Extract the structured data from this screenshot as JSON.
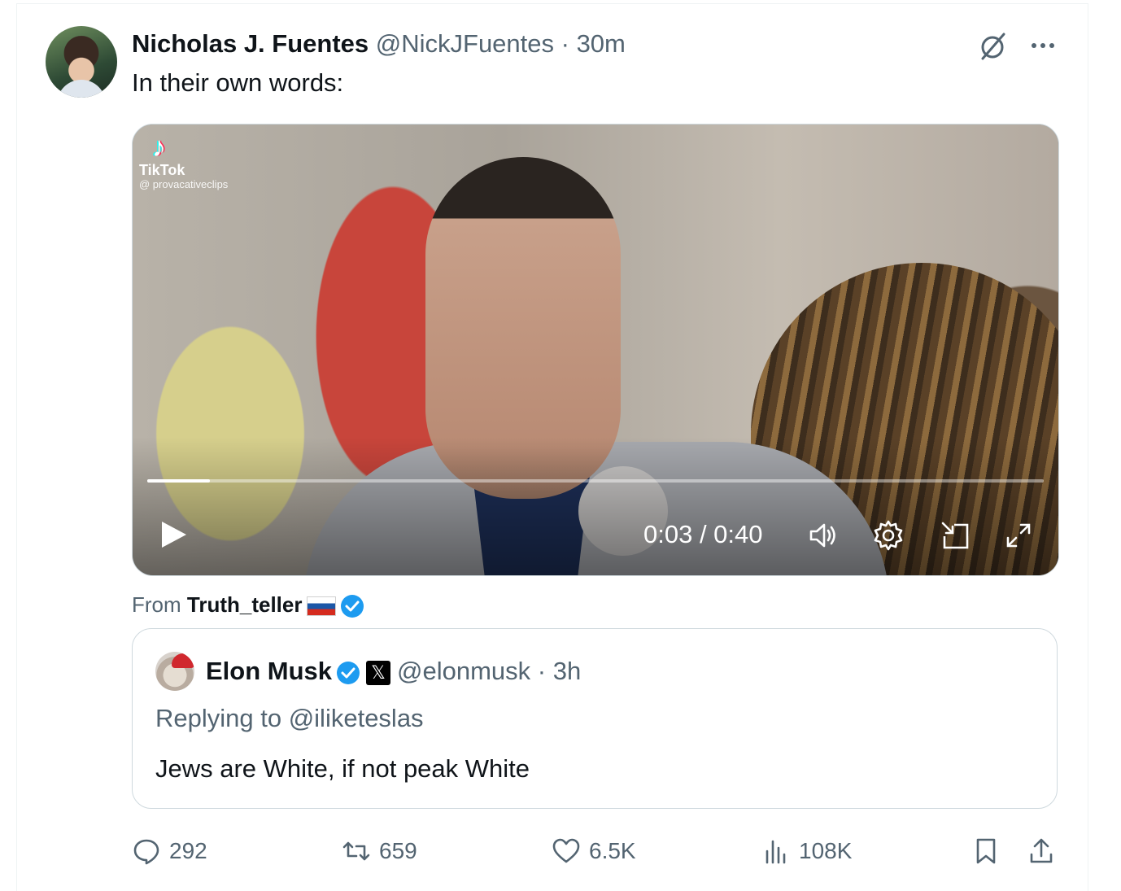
{
  "tweet": {
    "author_name": "Nicholas J. Fuentes",
    "author_meta": "@NickJFuentes · 30m",
    "text": "In their own words:"
  },
  "video": {
    "watermark_brand": "TikTok",
    "watermark_handle": "@ provacativeclips",
    "timecode": "0:03 / 0:40",
    "progress_fraction": 0.07
  },
  "source": {
    "prefix": "From ",
    "name": "Truth_teller"
  },
  "quoted_tweet": {
    "author_name": "Elon Musk",
    "x_badge": "𝕏",
    "author_meta": "@elonmusk · 3h",
    "reply_to": "Replying to @iliketeslas",
    "text": "Jews are White, if not peak White"
  },
  "actions": {
    "replies": "292",
    "reposts": "659",
    "likes": "6.5K",
    "views": "108K"
  },
  "colors": {
    "verified_blue": "#1d9bf0",
    "secondary_text": "#536471",
    "border": "#cfd9de"
  }
}
